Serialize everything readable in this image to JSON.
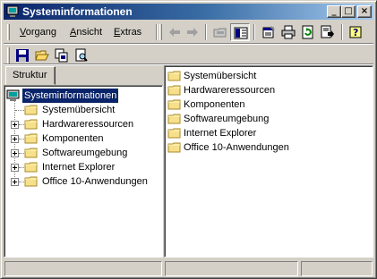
{
  "window": {
    "title": "Systeminformationen",
    "minimize_glyph": "_",
    "maximize_glyph": "□",
    "close_glyph": "×"
  },
  "menubar": {
    "items": [
      {
        "label": "Vorgang",
        "accel": "V",
        "rest": "organg"
      },
      {
        "label": "Ansicht",
        "accel": "A",
        "rest": "nsicht"
      },
      {
        "label": "Extras",
        "accel": "E",
        "rest": "xtras"
      }
    ]
  },
  "toolbar": {
    "icons": [
      "back-icon",
      "forward-icon",
      "up-folder-icon",
      "show-tree-icon",
      "properties-icon",
      "print-icon",
      "refresh-icon",
      "export-icon",
      "help-icon"
    ]
  },
  "toolbar2": {
    "icons": [
      "save-icon",
      "open-icon",
      "copy-icon",
      "find-icon"
    ]
  },
  "tabs": {
    "active": "Struktur"
  },
  "tree": {
    "root": "Systeminformationen",
    "items": [
      {
        "label": "Systemübersicht",
        "expandable": false
      },
      {
        "label": "Hardwareressourcen",
        "expandable": true
      },
      {
        "label": "Komponenten",
        "expandable": true
      },
      {
        "label": "Softwareumgebung",
        "expandable": true
      },
      {
        "label": "Internet Explorer",
        "expandable": true
      },
      {
        "label": "Office 10-Anwendungen",
        "expandable": true
      }
    ]
  },
  "list": {
    "items": [
      {
        "label": "Systemübersicht"
      },
      {
        "label": "Hardwareressourcen"
      },
      {
        "label": "Komponenten"
      },
      {
        "label": "Softwareumgebung"
      },
      {
        "label": "Internet Explorer"
      },
      {
        "label": "Office 10-Anwendungen"
      }
    ]
  },
  "colors": {
    "face": "#d4d0c8",
    "title_start": "#0a246a",
    "title_end": "#a6caf0",
    "folder": "#f7e08a",
    "folder_edge": "#a88a2a",
    "selection": "#0a246a"
  }
}
